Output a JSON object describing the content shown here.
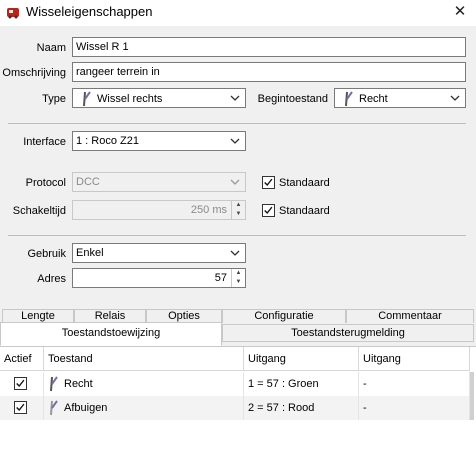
{
  "window": {
    "title": "Wisseleigenschappen",
    "close_glyph": "✕"
  },
  "form": {
    "naam_label": "Naam",
    "naam_value": "Wissel R 1",
    "omschrijving_label": "Omschrijving",
    "omschrijving_value": "rangeer terrein in",
    "type_label": "Type",
    "type_value": "Wissel rechts",
    "begintoestand_label": "Begintoestand",
    "begintoestand_value": "Recht",
    "interface_label": "Interface",
    "interface_value": "1 : Roco Z21",
    "protocol_label": "Protocol",
    "protocol_value": "DCC",
    "protocol_standaard_label": "Standaard",
    "protocol_standaard_checked": true,
    "schakeltijd_label": "Schakeltijd",
    "schakeltijd_value": "250 ms",
    "schakeltijd_standaard_label": "Standaard",
    "schakeltijd_standaard_checked": true,
    "gebruik_label": "Gebruik",
    "gebruik_value": "Enkel",
    "adres_label": "Adres",
    "adres_value": "57"
  },
  "tabs_row1": [
    "Lengte",
    "Relais",
    "Opties",
    "Configuratie",
    "Commentaar"
  ],
  "tabs_row2": [
    "Toestandstoewijzing",
    "Toestandsterugmelding"
  ],
  "active_tab": "Toestandstoewijzing",
  "table": {
    "headers": [
      "Actief",
      "Toestand",
      "Uitgang",
      "Uitgang"
    ],
    "rows": [
      {
        "actief": true,
        "toestand": "Recht",
        "uitgang1": "1 = 57 : Groen",
        "uitgang2": "-"
      },
      {
        "actief": true,
        "toestand": "Afbuigen",
        "uitgang1": "2 = 57 : Rood",
        "uitgang2": "-"
      }
    ]
  },
  "colors": {
    "accent": "#7a6ea8",
    "icon_red": "#b3261e"
  }
}
